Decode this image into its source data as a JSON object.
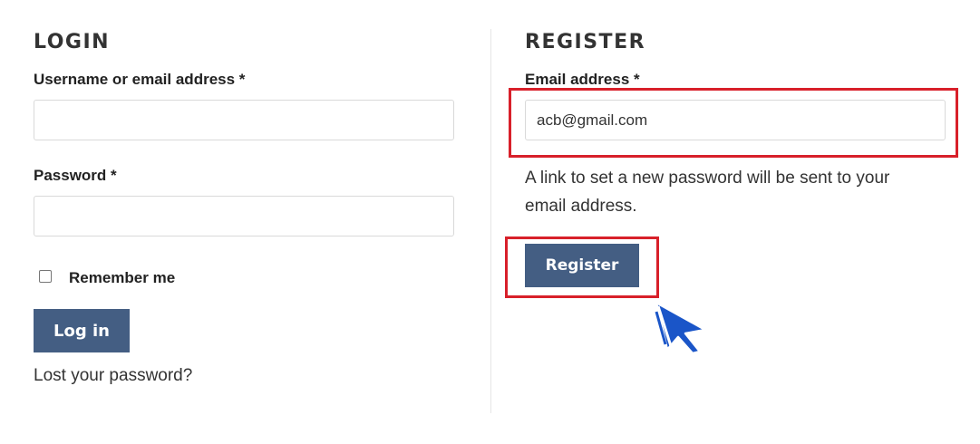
{
  "login": {
    "heading": "LOGIN",
    "username_label": "Username or email address *",
    "username_value": "",
    "password_label": "Password *",
    "password_value": "",
    "remember_label": "Remember me",
    "remember_checked": false,
    "login_button": "Log in",
    "lost_password_link": "Lost your password?"
  },
  "register": {
    "heading": "REGISTER",
    "email_label": "Email address *",
    "email_value": "acb@gmail.com",
    "info_text": "A link to set a new password will be sent to your email address.",
    "register_button": "Register"
  },
  "colors": {
    "button_bg": "#445e83",
    "highlight": "#d8202a",
    "cursor": "#1a55c8"
  },
  "icons": {
    "cursor": "cursor-arrow-icon"
  }
}
